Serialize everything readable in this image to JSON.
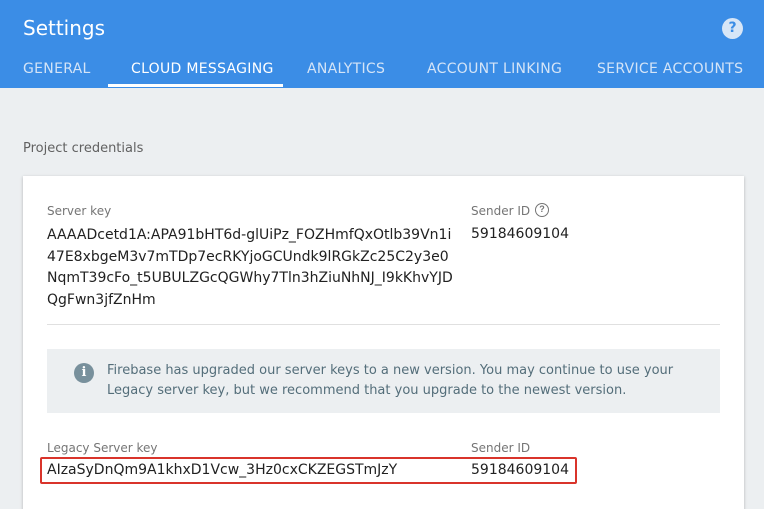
{
  "header": {
    "title": "Settings",
    "help_glyph": "?",
    "tabs": [
      {
        "label": "GENERAL",
        "active": false
      },
      {
        "label": "CLOUD MESSAGING",
        "active": true
      },
      {
        "label": "ANALYTICS",
        "active": false
      },
      {
        "label": "ACCOUNT LINKING",
        "active": false
      },
      {
        "label": "SERVICE ACCOUNTS",
        "active": false
      }
    ]
  },
  "section": {
    "title": "Project credentials"
  },
  "server_key": {
    "label": "Server key",
    "value": "AAAADcetd1A:APA91bHT6d-glUiPz_FOZHmfQxOtlb39Vn1i47E8xbgeM3v7mTDp7ecRKYjoGCUndk9lRGkZc25C2y3e0NqmT39cFo_t5UBULZGcQGWhy7Tln3hZiuNhNJ_I9kKhvYJDQgFwn3jfZnHm",
    "sender_label": "Sender ID",
    "sender_value": "59184609104",
    "help_glyph": "?"
  },
  "info": {
    "icon_glyph": "i",
    "message": "Firebase has upgraded our server keys to a new version. You may continue to use your Legacy server key, but we recommend that you upgrade to the newest version."
  },
  "legacy_key": {
    "label": "Legacy Server key",
    "value": "AIzaSyDnQm9A1khxD1Vcw_3Hz0cxCKZEGSTmJzY",
    "sender_label": "Sender ID",
    "sender_value": "59184609104"
  },
  "colors": {
    "header_bg": "#3b8de6",
    "highlight_border": "#d9342b",
    "info_bg": "#eceff1"
  }
}
